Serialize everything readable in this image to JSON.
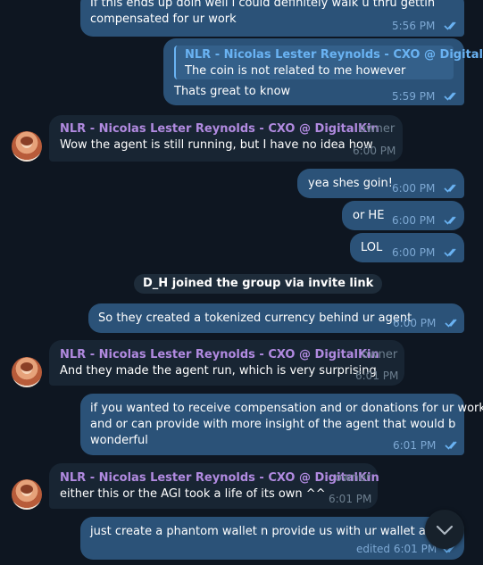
{
  "colors": {
    "background": "#0e1621",
    "outgoing_bubble": "#2b5278",
    "incoming_bubble": "#182533",
    "sender_name": "#b18ae0",
    "reply_accent": "#6ab3f3"
  },
  "messages": [
    {
      "lines": [
        "If this ends up doin well i could definitely walk u thru gettin",
        "compensated for ur work"
      ],
      "time": "5:56 PM"
    },
    {
      "reply_sender": "NLR - Nicolas Lester Reynolds - CXO @ DigitalKin",
      "reply_text": "The coin is not related to me however",
      "lines": [
        "Thats great to know"
      ],
      "time": "5:59 PM"
    },
    {
      "sender": "NLR - Nicolas Lester Reynolds - CXO @ DigitalKin",
      "role": "owner",
      "lines": [
        "Wow the agent is still running, but I have no idea how"
      ],
      "time": "6:00 PM"
    },
    {
      "lines": [
        "yea shes goin!"
      ],
      "time": "6:00 PM"
    },
    {
      "lines": [
        "or HE"
      ],
      "time": "6:00 PM"
    },
    {
      "lines": [
        "LOL"
      ],
      "time": "6:00 PM"
    },
    {
      "service_text": "D_H joined the group via invite link"
    },
    {
      "lines": [
        "So they created a tokenized currency behind ur agent"
      ],
      "time": "6:00 PM"
    },
    {
      "sender": "NLR - Nicolas Lester Reynolds - CXO @ DigitalKin",
      "role": "owner",
      "lines": [
        "And they made the agent run, which is very surprising"
      ],
      "time": "6:01 PM"
    },
    {
      "lines": [
        "if you wanted to receive compensation and or donations for ur work",
        "and or can provide with more insight of the agent that would b",
        "wonderful"
      ],
      "time": "6:01 PM"
    },
    {
      "sender": "NLR - Nicolas Lester Reynolds - CXO @ DigitalKin",
      "role": "owner",
      "lines": [
        "either this or the AGI took a life of its own ^^"
      ],
      "time": "6:01 PM"
    },
    {
      "lines": [
        "just create a phantom wallet n provide us with ur wallet address"
      ],
      "time": "edited 6:01 PM"
    }
  ],
  "icons": {
    "read_receipt": "double-check-icon",
    "scroll_down": "chevron-down-icon"
  }
}
